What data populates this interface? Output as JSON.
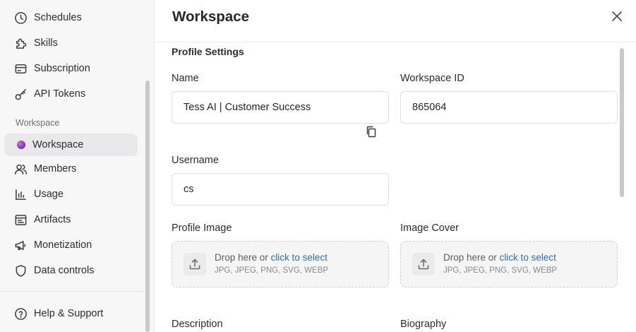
{
  "sidebar": {
    "items_top": [
      {
        "label": "Schedules",
        "icon": "clock-icon"
      },
      {
        "label": "Skills",
        "icon": "puzzle-icon"
      },
      {
        "label": "Subscription",
        "icon": "card-icon"
      },
      {
        "label": "API Tokens",
        "icon": "key-icon"
      }
    ],
    "section_label": "Workspace",
    "items_ws": [
      {
        "label": "Workspace",
        "icon": "workspace-avatar-icon"
      },
      {
        "label": "Members",
        "icon": "users-icon"
      },
      {
        "label": "Usage",
        "icon": "bar-chart-icon"
      },
      {
        "label": "Artifacts",
        "icon": "artifact-icon"
      },
      {
        "label": "Monetization",
        "icon": "megaphone-icon"
      },
      {
        "label": "Data controls",
        "icon": "shield-icon"
      }
    ],
    "help": {
      "label": "Help & Support",
      "icon": "help-icon"
    }
  },
  "main": {
    "title": "Workspace",
    "section_title": "Profile Settings",
    "name": {
      "label": "Name",
      "value": "Tess AI | Customer Success"
    },
    "workspace_id": {
      "label": "Workspace ID",
      "value": "865064"
    },
    "username": {
      "label": "Username",
      "value": "cs"
    },
    "profile_image": {
      "label": "Profile Image"
    },
    "image_cover": {
      "label": "Image Cover"
    },
    "dropzone": {
      "text": "Drop here or",
      "link": "click to select",
      "types": "JPG, JPEG, PNG, SVG, WEBP"
    },
    "description": {
      "label": "Description"
    },
    "biography": {
      "label": "Biography"
    }
  },
  "colors": {
    "link": "#2f6fa3",
    "active_bg": "#e9e9eb",
    "sidebar_bg": "#f7f7f7"
  }
}
